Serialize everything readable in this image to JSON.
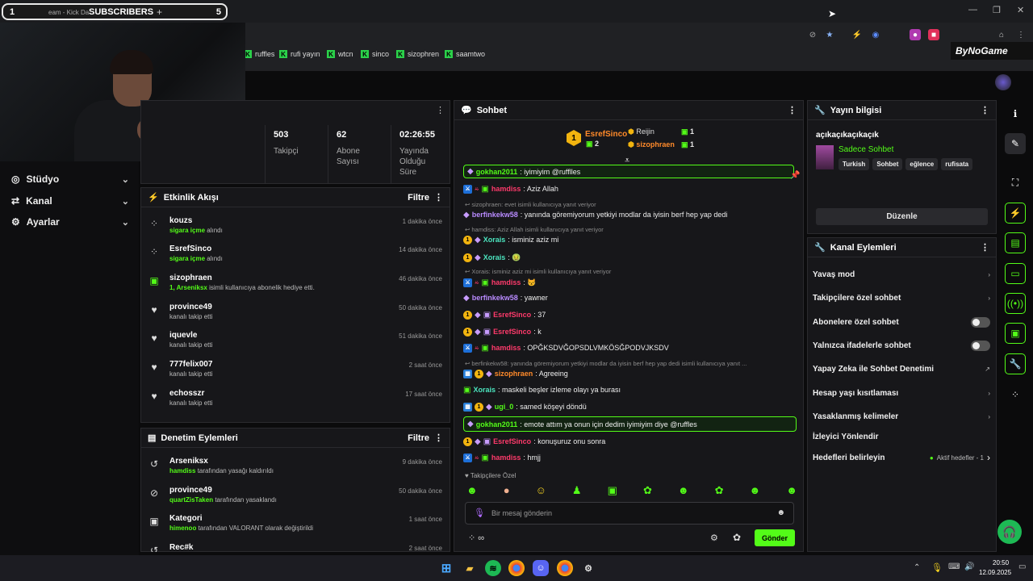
{
  "subscribers_overlay": {
    "left": "1",
    "tab_text": "eam - Kick Da",
    "label": "SUBSCRIBERS",
    "plus": "+",
    "right": "5"
  },
  "bookmarks": [
    "ruffles",
    "rufi yayın",
    "wtcn",
    "sinco",
    "sizophren",
    "saamtwo"
  ],
  "brand": "ByNoGame",
  "nav": [
    {
      "label": "Stüdyo",
      "icon": "studio-icon"
    },
    {
      "label": "Kanal",
      "icon": "channel-icon"
    },
    {
      "label": "Ayarlar",
      "icon": "settings-icon"
    }
  ],
  "stats": [
    {
      "value": "503",
      "label": "Takipçi"
    },
    {
      "value": "62",
      "label": "Abone Sayısı"
    },
    {
      "value": "02:26:55",
      "label": "Yayında Olduğu Süre"
    }
  ],
  "activity": {
    "title": "Etkinlik Akışı",
    "filter": "Filtre",
    "items": [
      {
        "name": "kouzs",
        "hl": "sigara içme",
        "rest": " alındı",
        "time": "1 dakika önce",
        "icon": "redeem-icon"
      },
      {
        "name": "EsrefSinco",
        "hl": "sigara içme",
        "rest": " alındı",
        "time": "14 dakika önce",
        "icon": "redeem-icon"
      },
      {
        "name": "sizophraen",
        "hl": "1, Arseniksx",
        "rest": " isimli kullanıcıya abonelik hediye etti.",
        "time": "46 dakika önce",
        "icon": "gift-icon"
      },
      {
        "name": "province49",
        "hl": "",
        "rest": "kanalı takip etti",
        "time": "50 dakika önce",
        "icon": "heart-icon"
      },
      {
        "name": "iquevle",
        "hl": "",
        "rest": "kanalı takip etti",
        "time": "51 dakika önce",
        "icon": "heart-icon"
      },
      {
        "name": "777felix007",
        "hl": "",
        "rest": "kanalı takip etti",
        "time": "2 saat önce",
        "icon": "heart-icon"
      },
      {
        "name": "echosszr",
        "hl": "",
        "rest": "kanalı takip etti",
        "time": "17 saat önce",
        "icon": "heart-icon"
      }
    ]
  },
  "moderation": {
    "title": "Denetim Eylemleri",
    "filter": "Filtre",
    "items": [
      {
        "name": "Arseniksx",
        "hl": "hamdiss",
        "rest": " tarafından yasağı kaldırıldı",
        "time": "9 dakika önce",
        "icon": "undo-icon"
      },
      {
        "name": "province49",
        "hl": "quartZisTaken",
        "rest": " tarafından yasaklandı",
        "time": "50 dakika önce",
        "icon": "ban-icon"
      },
      {
        "name": "Kategori",
        "hl": "himenoo",
        "rest": " tarafından VALORANT olarak değiştirildi",
        "time": "1 saat önce",
        "icon": "category-icon"
      },
      {
        "name": "Rec#k",
        "hl": "",
        "rest": "",
        "time": "2 saat önce",
        "icon": "undo-icon"
      }
    ]
  },
  "chat": {
    "title": "Sohbet",
    "leaders": [
      {
        "rank": "1",
        "name": "EsrefSinco",
        "count": "2"
      },
      {
        "name": "Reijin",
        "count": "1"
      },
      {
        "name": "sizophraen",
        "count": "1"
      }
    ],
    "pinned": {
      "user": "gokhan2011",
      "text": ": iyimiyim @rufflles"
    },
    "messages": [
      {
        "reply": "",
        "user": "hamdiss",
        "color": "pink",
        "text": ": Aziz Allah",
        "badges": "mod"
      },
      {
        "reply": "sizophraen: evet isimli kullanıcıya yanıt veriyor",
        "user": "berfinkekw58",
        "color": "purple",
        "text": ": yanında göremiyorum yetkiyi modlar da iyisin berf hep yap dedi",
        "badges": "gift"
      },
      {
        "reply": "hamdiss: Aziz Allah isimli kullanıcıya yanıt veriyor",
        "user": "Xorais",
        "color": "teal",
        "text": ": isminiz aziz mi",
        "badges": "sub"
      },
      {
        "reply": "",
        "user": "Xorais",
        "color": "teal",
        "text": ": 🤢",
        "badges": "sub"
      },
      {
        "reply": "Xorais: isminiz aziz mi isimli kullanıcıya yanıt veriyor",
        "user": "hamdiss",
        "color": "pink",
        "text": ": 😾",
        "badges": "mod"
      },
      {
        "reply": "",
        "user": "berfinkekw58",
        "color": "purple",
        "text": ": yawner",
        "badges": "gift"
      },
      {
        "reply": "",
        "user": "EsrefSinco",
        "color": "pink",
        "text": ": 37",
        "badges": "sub"
      },
      {
        "reply": "",
        "user": "EsrefSinco",
        "color": "pink",
        "text": ": k",
        "badges": "sub"
      },
      {
        "reply": "",
        "user": "hamdiss",
        "color": "pink",
        "text": ": OPĞKSDVĞOPSDLVMKÖSĞPODVJKSDV",
        "badges": "mod"
      },
      {
        "reply": "berfinkekw58: yanında göremiyorum yetkiyi modlar da iyisin berf hep yap dedi isimli kullanıcıya yanıt ...",
        "user": "sizophraen",
        "color": "orange",
        "text": ": Agreeing",
        "badges": "sub"
      },
      {
        "reply": "",
        "user": "Xorais",
        "color": "teal",
        "text": ": maskeli beşler izleme olayı ya burası",
        "badges": "gift"
      },
      {
        "reply": "",
        "user": "ugi_0",
        "color": "green",
        "text": ": samed köşeyi döndü",
        "badges": "sub"
      },
      {
        "reply": "",
        "user": "gokhan2011",
        "color": "green",
        "text": ": emote attım ya onun için dedim iyimiyim diye @ruffles",
        "badges": "highlight"
      },
      {
        "reply": "",
        "user": "EsrefSinco",
        "color": "pink",
        "text": ": konuşuruz onu sonra",
        "badges": "sub"
      },
      {
        "reply": "",
        "user": "hamdiss",
        "color": "pink",
        "text": ": hmjj",
        "badges": "mod"
      }
    ],
    "follower_only": "Takipçilere Özel",
    "input_placeholder": "Bir mesaj gönderin",
    "send": "Gönder"
  },
  "stream_info": {
    "title": "Yayın bilgisi",
    "stream_title": "açıkaçıkaçıkaçık",
    "category": "Sadece Sohbet",
    "tags": [
      "Turkish",
      "Sohbet",
      "eğlence",
      "rufisata"
    ],
    "edit": "Düzenle"
  },
  "channel_actions": {
    "title": "Kanal Eylemleri",
    "items": [
      {
        "label": "Yavaş mod",
        "kind": "chev"
      },
      {
        "label": "Takipçilere özel sohbet",
        "kind": "chev"
      },
      {
        "label": "Abonelere özel sohbet",
        "kind": "toggle"
      },
      {
        "label": "Yalnızca ifadelerle sohbet",
        "kind": "toggle"
      },
      {
        "label": "Yapay Zeka ile Sohbet Denetimi",
        "kind": "ext"
      },
      {
        "label": "Hesap yaşı kısıtlaması",
        "kind": "chev"
      },
      {
        "label": "Yasaklanmış kelimeler",
        "kind": "chev"
      },
      {
        "label": "İzleyici Yönlendir",
        "kind": "none"
      },
      {
        "label": "Hedefleri belirleyin",
        "kind": "goals",
        "extra": "Aktif hedefler - 1"
      }
    ]
  },
  "taskbar": {
    "time": "20:50",
    "date": "12.09.2025"
  }
}
